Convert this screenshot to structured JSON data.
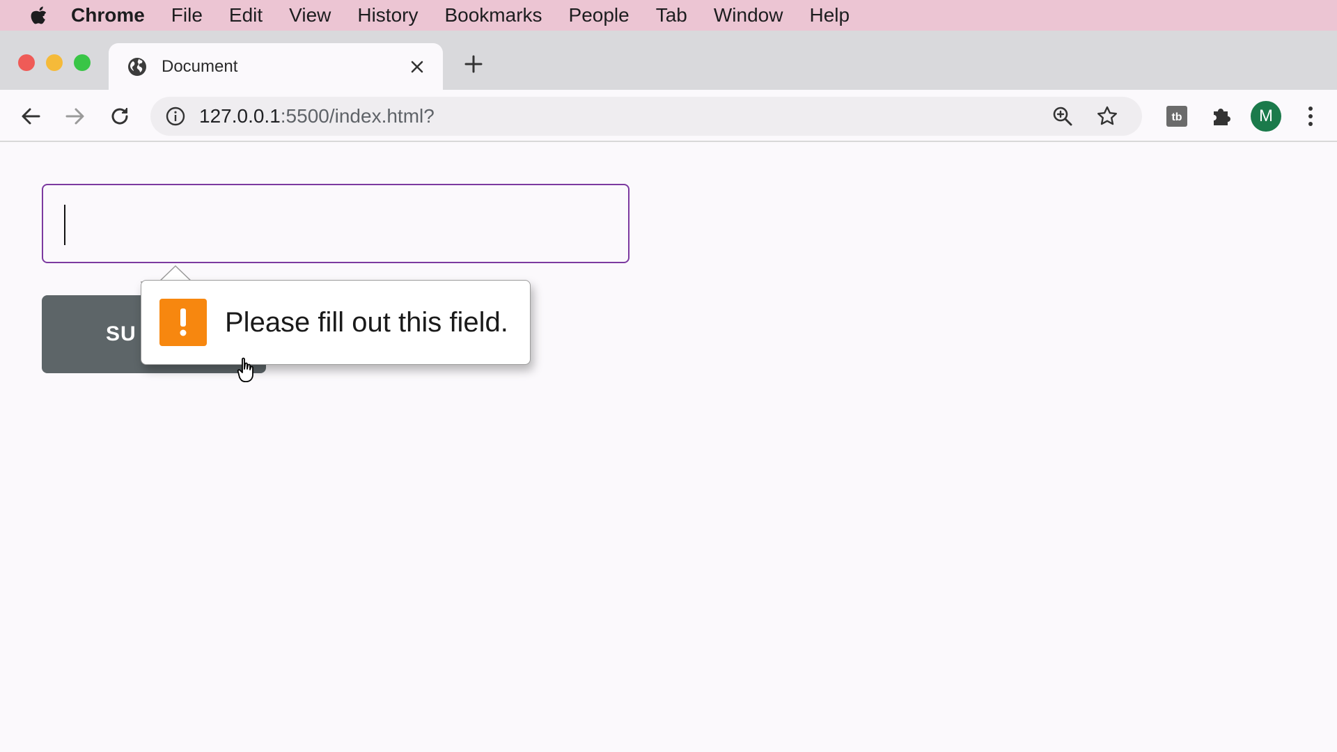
{
  "menubar": {
    "app_name": "Chrome",
    "items": [
      "File",
      "Edit",
      "View",
      "History",
      "Bookmarks",
      "People",
      "Tab",
      "Window",
      "Help"
    ]
  },
  "tab": {
    "title": "Document",
    "favicon": "globe-icon"
  },
  "toolbar": {
    "url_host": "127.0.0.1",
    "url_rest": ":5500/index.html?",
    "avatar_letter": "M",
    "avatar_color": "#1b7a4b"
  },
  "form": {
    "input_value": "",
    "submit_label": "SU"
  },
  "tooltip": {
    "message": "Please fill out this field.",
    "icon": "warning-icon",
    "icon_color": "#f7870f"
  },
  "colors": {
    "menubar_bg": "#ecc5d3",
    "input_border": "#7c3aa0",
    "button_bg": "#5d6568"
  }
}
